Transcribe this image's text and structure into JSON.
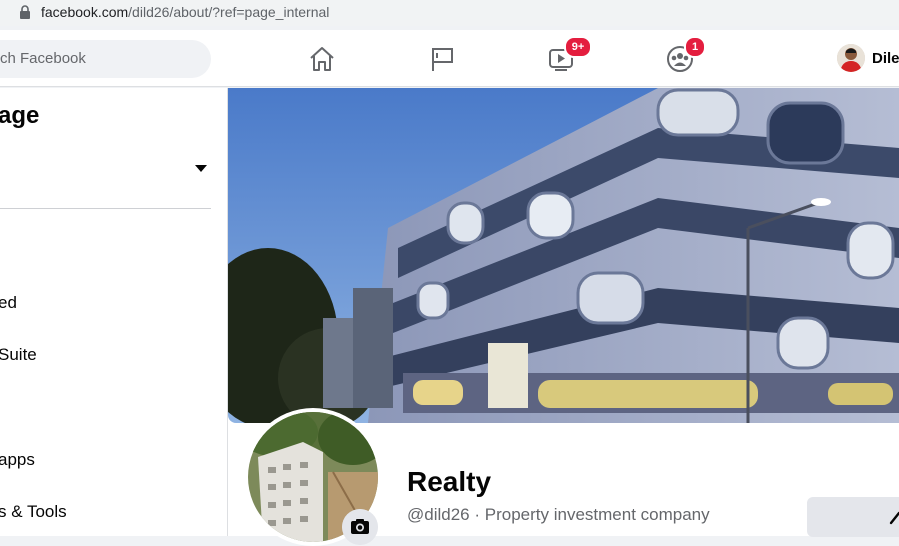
{
  "browser": {
    "url_host": "facebook.com",
    "url_path": "/dild26/about/?ref=page_internal"
  },
  "nav": {
    "search_placeholder": "ch Facebook",
    "video_badge": "9+",
    "groups_badge": "1",
    "profile_name": "Dile"
  },
  "sidebar": {
    "title": "age",
    "items": [
      {
        "label": "ed"
      },
      {
        "label": " Suite"
      },
      {
        "label": "apps"
      },
      {
        "label": "s & Tools"
      }
    ]
  },
  "page": {
    "name": "Realty",
    "handle": "@dild26",
    "separator": " · ",
    "category": "Property investment company"
  },
  "colors": {
    "badge": "#e41e3f",
    "nav_icon": "#65676b",
    "fb_bg": "#f0f2f5"
  }
}
